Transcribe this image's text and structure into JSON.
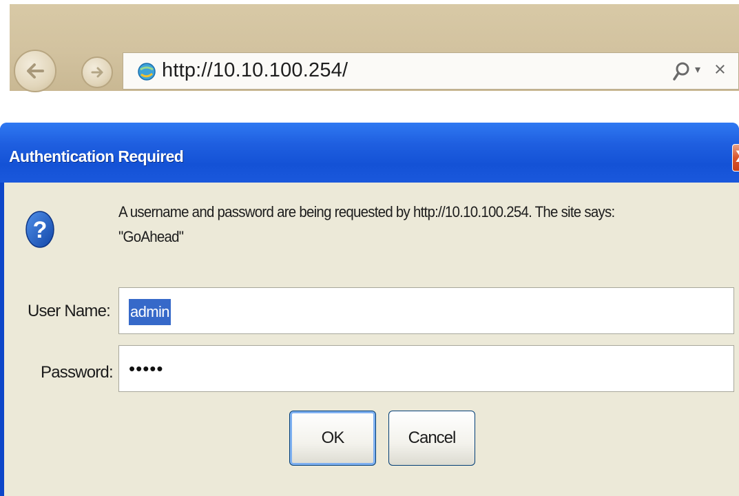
{
  "browser": {
    "url": "http://10.10.100.254/",
    "icons": {
      "back": "back-arrow-icon",
      "forward": "forward-arrow-icon",
      "site": "ie-globe-icon",
      "search": "search-icon",
      "dropdown": "chevron-down-icon",
      "stop": "close-icon"
    },
    "search_glyph": "ρ",
    "dropdown_glyph": "▾",
    "stop_glyph": "×"
  },
  "dialog": {
    "title": "Authentication Required",
    "close_glyph": "X",
    "message_line1": "A username and password are being requested by http://10.10.100.254. The site says:",
    "message_line2": "\"GoAhead\"",
    "icon": "question-icon",
    "username_label": "User Name:",
    "username_value": "admin",
    "password_label": "Password:",
    "password_mask": "•••••",
    "ok_label": "OK",
    "cancel_label": "Cancel",
    "colors": {
      "titlebar": "#1f5fe0",
      "client": "#ece9d8",
      "selection": "#3669c9",
      "close_button": "#d9552c"
    }
  }
}
